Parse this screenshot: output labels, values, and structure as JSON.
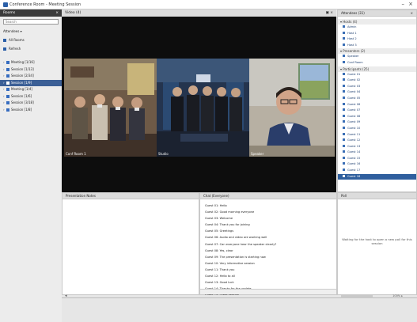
{
  "window": {
    "title": "Conference Room - Meeting Session",
    "min": "–",
    "close": "×"
  },
  "room_panel": {
    "title": "Rooms",
    "close": "×",
    "search_placeholder": "Search",
    "line1": "Attendees ▾",
    "line2": "All Rooms",
    "line3": "Refresh",
    "items": [
      {
        "label": "Meeting [1/16]",
        "active": false
      },
      {
        "label": "Session [1/13]",
        "active": false
      },
      {
        "label": "Session [2/34]",
        "active": false
      },
      {
        "label": "Session [1/9]",
        "active": true
      },
      {
        "label": "Meeting [1/4]",
        "active": false
      },
      {
        "label": "Session [1/6]",
        "active": false
      },
      {
        "label": "Session [3/18]",
        "active": false
      },
      {
        "label": "Session [1/8]",
        "active": false
      }
    ]
  },
  "video": {
    "title": "Video (4)",
    "controls": "▣ ×",
    "tiles": [
      {
        "caption": "Conf Room 1"
      },
      {
        "caption": "Studio"
      },
      {
        "caption": "Speaker"
      }
    ]
  },
  "attendees": {
    "title": "Attendees (31)",
    "close": "×",
    "cat_hosts": "▾ Hosts (4)",
    "hosts": [
      "Admin",
      "Host 1",
      "Host 2",
      "Host 3"
    ],
    "cat_presenters": "▾ Presenters (2)",
    "presenters": [
      "Speaker",
      "Conf Room"
    ],
    "cat_participants": "▾ Participants (25)",
    "participants": [
      "Guest 01",
      "Guest 02",
      "Guest 03",
      "Guest 04",
      "Guest 05",
      "Guest 06",
      "Guest 07",
      "Guest 08",
      "Guest 09",
      "Guest 10",
      "Guest 11",
      "Guest 12",
      "Guest 13",
      "Guest 14",
      "Guest 15",
      "Guest 16",
      "Guest 17",
      "Guest 18"
    ],
    "highlighted_index": 17
  },
  "notes": {
    "title": "Presentation Notes"
  },
  "chat": {
    "title": "Chat (Everyone)",
    "messages": [
      "Guest 01: Hello",
      "Guest 02: Good morning everyone",
      "Guest 03: Welcome",
      "Guest 04: Thank you for joining",
      "Guest 05: Greetings",
      "Guest 06: Audio and video are working well",
      "Guest 07: Can everyone hear the speaker clearly?",
      "Guest 08: Yes, clear",
      "Guest 09: The presentation is starting now",
      "Guest 10: Very informative session",
      "Guest 11: Thank you",
      "Guest 12: Hello to all",
      "Guest 13: Good luck",
      "Guest 14: Thanks for the update",
      "Guest 15: Great session",
      "Guest 16: Thank you",
      "Guest 17: Goodbye"
    ]
  },
  "poll": {
    "title": "Poll",
    "text": "Waiting for the host to open a new poll for this session"
  },
  "bottom": {
    "left_icon": "◂",
    "status": "100% ▸"
  },
  "colors": {
    "accent": "#3b5f96",
    "header_dark": "#3b3b3b",
    "video_bg": "#0d0d0d"
  }
}
